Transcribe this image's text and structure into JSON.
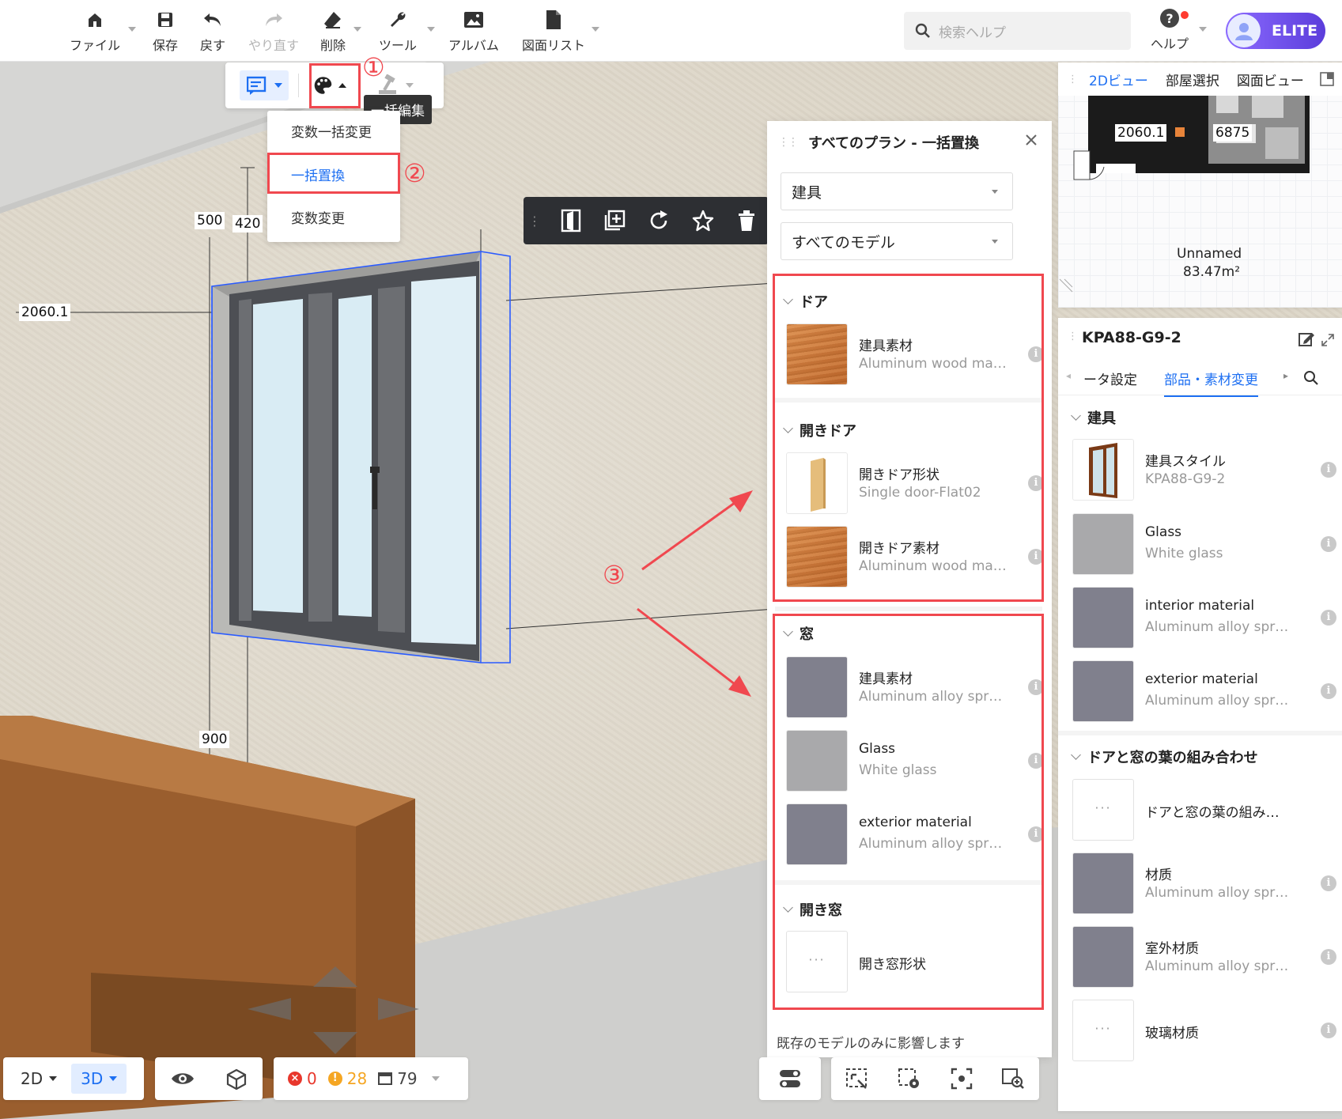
{
  "toolbar": {
    "file": "ファイル",
    "save": "保存",
    "undo": "戻す",
    "redo": "やり直す",
    "delete": "削除",
    "tools": "ツール",
    "album": "アルバム",
    "drawing_list": "図面リスト",
    "search_placeholder": "検索ヘルプ",
    "help": "ヘルプ",
    "badge": "ELITE"
  },
  "edit_bar": {
    "tooltip": "一括編集",
    "marker1": "①",
    "marker2": "②",
    "marker3": "③"
  },
  "dropdown": {
    "items": [
      "変数一括変更",
      "一括置換",
      "変数変更"
    ],
    "selected": "一括置換"
  },
  "dimensions": {
    "d500": "500",
    "d420": "420",
    "d2060": "2060.1",
    "d900": "900"
  },
  "replace_panel": {
    "title": "すべてのプラン - 一括置換",
    "category": "建具",
    "model_filter": "すべてのモデル",
    "groups": [
      {
        "name": "ドア",
        "items": [
          {
            "name": "建具素材",
            "value": "Aluminum wood ma…",
            "swatch": "wood"
          }
        ]
      },
      {
        "name": "開きドア",
        "items": [
          {
            "name": "開きドア形状",
            "value": "Single door-Flat02",
            "swatch": "door"
          },
          {
            "name": "開きドア素材",
            "value": "Aluminum wood ma…",
            "swatch": "wood"
          }
        ]
      },
      {
        "name": "窓",
        "items": [
          {
            "name": "建具素材",
            "value": "Aluminum alloy spr…",
            "swatch": "grey1"
          },
          {
            "name": "Glass",
            "value": "White glass",
            "swatch": "grey2"
          },
          {
            "name": "exterior material",
            "value": "Aluminum alloy spr…",
            "swatch": "grey1"
          }
        ]
      },
      {
        "name": "開き窓",
        "items": [
          {
            "name": "開き窓形状",
            "value": "",
            "swatch": "dots"
          }
        ]
      }
    ],
    "footer": "既存のモデルのみに影響します"
  },
  "view_panel": {
    "tabs": [
      "2Dビュー",
      "部屋選択",
      "図面ビュー"
    ],
    "active_tab": "2Dビュー",
    "label_a": "2060.1",
    "label_b": "6875",
    "plan_name": "Unnamed",
    "area": "83.47m²"
  },
  "property_panel": {
    "title": "KPA88-G9-2",
    "tab_left": "ータ設定",
    "tab_active": "部品・素材変更",
    "section1": "建具",
    "items1": [
      {
        "name": "建具スタイル",
        "value": "KPA88-G9-2",
        "swatch": "window"
      },
      {
        "name": "Glass",
        "value": "White glass",
        "swatch": "grey2"
      },
      {
        "name": "interior material",
        "value": "Aluminum alloy spr…",
        "swatch": "grey1"
      },
      {
        "name": "exterior material",
        "value": "Aluminum alloy spr…",
        "swatch": "grey1"
      }
    ],
    "section2": "ドアと窓の葉の組み合わせ",
    "items2": [
      {
        "name": "ドアと窓の葉の組み…",
        "value": "",
        "swatch": "dots"
      },
      {
        "name": "材质",
        "value": "Aluminum alloy spr…",
        "swatch": "grey1"
      },
      {
        "name": "室外材质",
        "value": "Aluminum alloy spr…",
        "swatch": "grey1"
      },
      {
        "name": "玻璃材质",
        "value": "",
        "swatch": "dots"
      }
    ]
  },
  "bottom": {
    "mode_2d": "2D",
    "mode_3d": "3D",
    "errors": "0",
    "warnings": "28",
    "models": "79"
  },
  "colors": {
    "accent": "#1d6ff2",
    "highlight": "#f0484f",
    "error": "#e8372c",
    "warning": "#f5a623"
  }
}
